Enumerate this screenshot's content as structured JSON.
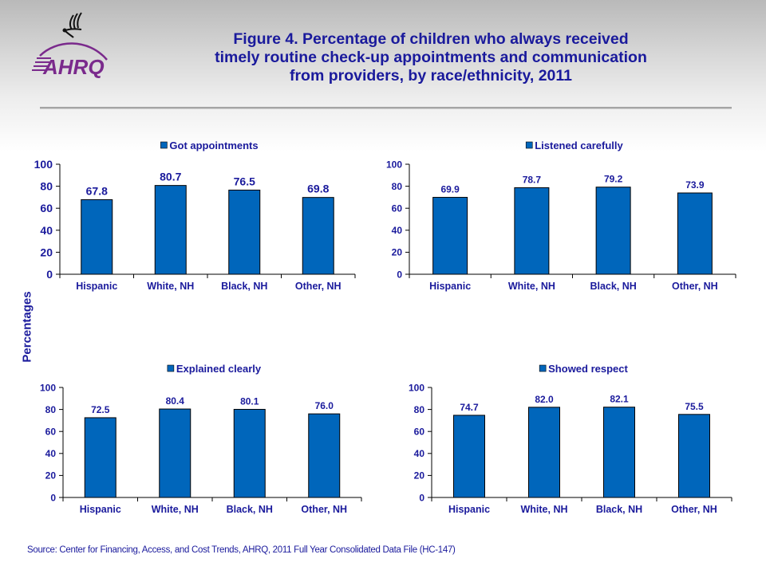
{
  "header": {
    "logo_text": "AHRQ",
    "title_lines": [
      "Figure 4. Percentage of children who always received",
      "timely routine check-up appointments and communication",
      "from providers, by race/ethnicity, 2011"
    ]
  },
  "shared_ylabel": "Percentages",
  "source": "Source: Center for Financing, Access, and Cost Trends, AHRQ,  2011 Full Year Consolidated Data File (HC-147)",
  "colors": {
    "bar": "#0066bb",
    "text": "#1a1a9c",
    "axis": "#000000"
  },
  "chart_data": [
    {
      "type": "bar",
      "title": "",
      "legend": "Got appointments",
      "legend_position": "top-center",
      "categories": [
        "Hispanic",
        "White, NH",
        "Black, NH",
        "Other, NH"
      ],
      "values": [
        67.8,
        80.7,
        76.5,
        69.8
      ],
      "value_labels": [
        "67.8",
        "80.7",
        "76.5",
        "69.8"
      ],
      "xlabel": "",
      "ylabel": "Percentages",
      "ylim": [
        0,
        100
      ],
      "yticks": [
        0,
        20,
        40,
        60,
        80,
        100
      ],
      "grid": false
    },
    {
      "type": "bar",
      "title": "",
      "legend": "Listened carefully",
      "legend_position": "top-center",
      "categories": [
        "Hispanic",
        "White, NH",
        "Black, NH",
        "Other, NH"
      ],
      "values": [
        69.9,
        78.7,
        79.2,
        73.9
      ],
      "value_labels": [
        "69.9",
        "78.7",
        "79.2",
        "73.9"
      ],
      "xlabel": "",
      "ylabel": "Percentages",
      "ylim": [
        0,
        100
      ],
      "yticks": [
        0,
        20,
        40,
        60,
        80,
        100
      ],
      "grid": false
    },
    {
      "type": "bar",
      "title": "",
      "legend": "Explained clearly",
      "legend_position": "top-center",
      "categories": [
        "Hispanic",
        "White, NH",
        "Black, NH",
        "Other, NH"
      ],
      "values": [
        72.5,
        80.4,
        80.1,
        76.0
      ],
      "value_labels": [
        "72.5",
        "80.4",
        "80.1",
        "76.0"
      ],
      "xlabel": "",
      "ylabel": "Percentages",
      "ylim": [
        0,
        100
      ],
      "yticks": [
        0,
        20,
        40,
        60,
        80,
        100
      ],
      "grid": false
    },
    {
      "type": "bar",
      "title": "",
      "legend": "Showed respect",
      "legend_position": "top-center",
      "categories": [
        "Hispanic",
        "White, NH",
        "Black, NH",
        "Other, NH"
      ],
      "values": [
        74.7,
        82.0,
        82.1,
        75.5
      ],
      "value_labels": [
        "74.7",
        "82.0",
        "82.1",
        "75.5"
      ],
      "xlabel": "",
      "ylabel": "Percentages",
      "ylim": [
        0,
        100
      ],
      "yticks": [
        0,
        20,
        40,
        60,
        80,
        100
      ],
      "grid": false
    }
  ]
}
